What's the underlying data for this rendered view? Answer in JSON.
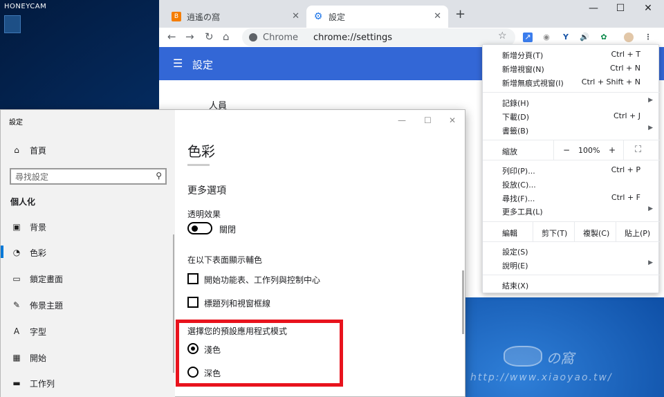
{
  "watermark": "HONEYCAM",
  "watermark_url": "http://www.xiaoyao.tw/",
  "watermark_logo": "の窩",
  "chrome": {
    "tabs": [
      {
        "title": "逍遙の窩",
        "close": "✕"
      },
      {
        "title": "設定",
        "close": "✕"
      }
    ],
    "new_tab": "+",
    "window_controls": {
      "minimize": "—",
      "maximize": "☐",
      "close": "✕"
    },
    "omnibox": {
      "chip": "Chrome",
      "url": "chrome://settings"
    },
    "settings_header": "設定",
    "people_label": "人員",
    "menu": {
      "items_top": [
        {
          "label": "新增分頁(T)",
          "shortcut": "Ctrl + T"
        },
        {
          "label": "新增視窗(N)",
          "shortcut": "Ctrl + N"
        },
        {
          "label": "新增無痕式視窗(I)",
          "shortcut": "Ctrl + Shift + N"
        }
      ],
      "items_mid": [
        {
          "label": "記錄(H)",
          "shortcut": "",
          "arrow": "▶"
        },
        {
          "label": "下載(D)",
          "shortcut": "Ctrl + J",
          "arrow": ""
        },
        {
          "label": "書籤(B)",
          "shortcut": "",
          "arrow": "▶"
        }
      ],
      "zoom": {
        "label": "縮放",
        "minus": "−",
        "value": "100%",
        "plus": "+",
        "fullscreen": "⛶"
      },
      "items_tools": [
        {
          "label": "列印(P)...",
          "shortcut": "Ctrl + P",
          "arrow": ""
        },
        {
          "label": "投放(C)...",
          "shortcut": "",
          "arrow": ""
        },
        {
          "label": "尋找(F)...",
          "shortcut": "Ctrl + F",
          "arrow": ""
        },
        {
          "label": "更多工具(L)",
          "shortcut": "",
          "arrow": "▶"
        }
      ],
      "edit": {
        "label": "編輯",
        "cut": "剪下(T)",
        "copy": "複製(C)",
        "paste": "貼上(P)"
      },
      "items_bottom": [
        {
          "label": "設定(S)",
          "arrow": ""
        },
        {
          "label": "說明(E)",
          "arrow": "▶"
        }
      ],
      "exit": "結束(X)"
    }
  },
  "win_settings": {
    "title": "設定",
    "home": "首頁",
    "search_placeholder": "尋找設定",
    "section": "個人化",
    "nav": [
      {
        "label": "背景"
      },
      {
        "label": "色彩"
      },
      {
        "label": "鎖定畫面"
      },
      {
        "label": "佈景主題"
      },
      {
        "label": "字型"
      },
      {
        "label": "開始"
      },
      {
        "label": "工作列"
      }
    ],
    "page_title": "色彩",
    "more_options": "更多選項",
    "transparency_label": "透明效果",
    "transparency_state": "關閉",
    "accent_surfaces_label": "在以下表面顯示輔色",
    "check_start": "開始功能表、工作列與控制中心",
    "check_titlebar": "標題列和視窗框線",
    "app_mode_label": "選擇您的預設應用程式模式",
    "mode_light": "淺色",
    "mode_dark": "深色"
  },
  "colors": {
    "chrome_blue": "#3367d6",
    "highlight_red": "#e8131d",
    "win_accent": "#0078d7"
  }
}
